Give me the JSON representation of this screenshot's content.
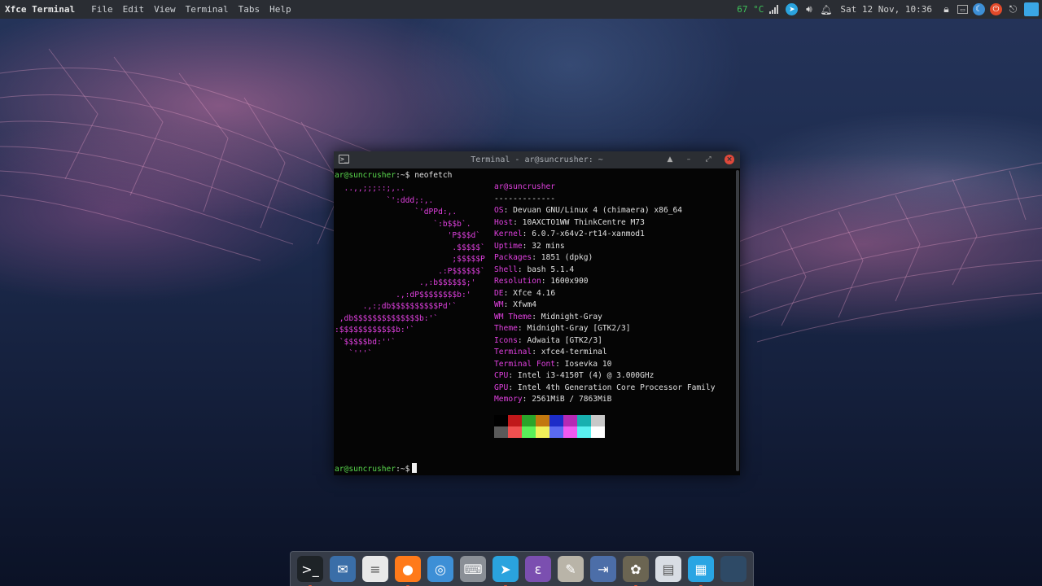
{
  "panel": {
    "app_name": "Xfce Terminal",
    "menus": [
      "File",
      "Edit",
      "View",
      "Terminal",
      "Tabs",
      "Help"
    ],
    "temperature": "67 °C",
    "clock": "Sat 12 Nov, 10:36"
  },
  "terminal": {
    "title": "Terminal - ar@suncrusher: ~",
    "prompt_user": "ar@suncrusher",
    "prompt_path": ":~$",
    "command": "neofetch",
    "ascii_logo": "  ..,,;;;::;,..\n           `':ddd;:,.\n                 `'dPPd:,.\n                     `:b$$b`.\n                        'P$$$d`\n                         .$$$$$`\n                         ;$$$$$P\n                      .:P$$$$$$`\n                  .,:b$$$$$$;'\n             .,:dP$$$$$$$$b:'\n      .,:;db$$$$$$$$$$Pd'`\n ,db$$$$$$$$$$$$$$b:'`\n:$$$$$$$$$$$$b:'`\n `$$$$$bd:''`\n   `'''`",
    "info_header": "ar@suncrusher",
    "separator": "-------------",
    "info": [
      {
        "key": "OS",
        "value": "Devuan GNU/Linux 4 (chimaera) x86_64"
      },
      {
        "key": "Host",
        "value": "10AXCTO1WW ThinkCentre M73"
      },
      {
        "key": "Kernel",
        "value": "6.0.7-x64v2-rt14-xanmod1"
      },
      {
        "key": "Uptime",
        "value": "32 mins"
      },
      {
        "key": "Packages",
        "value": "1851 (dpkg)"
      },
      {
        "key": "Shell",
        "value": "bash 5.1.4"
      },
      {
        "key": "Resolution",
        "value": "1600x900"
      },
      {
        "key": "DE",
        "value": "Xfce 4.16"
      },
      {
        "key": "WM",
        "value": "Xfwm4"
      },
      {
        "key": "WM Theme",
        "value": "Midnight-Gray"
      },
      {
        "key": "Theme",
        "value": "Midnight-Gray [GTK2/3]"
      },
      {
        "key": "Icons",
        "value": "Adwaita [GTK2/3]"
      },
      {
        "key": "Terminal",
        "value": "xfce4-terminal"
      },
      {
        "key": "Terminal Font",
        "value": "Iosevka 10"
      },
      {
        "key": "CPU",
        "value": "Intel i3-4150T (4) @ 3.000GHz"
      },
      {
        "key": "GPU",
        "value": "Intel 4th Generation Core Processor Family"
      },
      {
        "key": "Memory",
        "value": "2561MiB / 7863MiB"
      }
    ],
    "palette_top": [
      "#000000",
      "#c0181a",
      "#2aa52a",
      "#c2780e",
      "#1c2cc8",
      "#b52ab5",
      "#18b0b0",
      "#c8c8c8"
    ],
    "palette_bottom": [
      "#5a5a5a",
      "#f05050",
      "#5af05a",
      "#f0f05a",
      "#5a6af0",
      "#f05af0",
      "#5af0f0",
      "#ffffff"
    ],
    "accent_prompt": "#59d84d",
    "accent_key": "#e040df"
  },
  "dock": {
    "items": [
      {
        "name": "terminal-dock-icon",
        "color": "#1e2327",
        "glyph": ">_"
      },
      {
        "name": "mail-dock-icon",
        "color": "#3a6ea8",
        "glyph": "✉"
      },
      {
        "name": "text-editor-dock-icon",
        "color": "#e8e8e8",
        "glyph": "≡"
      },
      {
        "name": "firefox-dock-icon",
        "color": "#ff7a1a",
        "glyph": "●"
      },
      {
        "name": "chromium-dock-icon",
        "color": "#3d8fd6",
        "glyph": "◎"
      },
      {
        "name": "keyboard-dock-icon",
        "color": "#8a8f96",
        "glyph": "⌨"
      },
      {
        "name": "telegram-dock-icon",
        "color": "#2aa3de",
        "glyph": "➤"
      },
      {
        "name": "emacs-dock-icon",
        "color": "#7b4fb0",
        "glyph": "ε"
      },
      {
        "name": "pencil-cup-dock-icon",
        "color": "#b9b4a8",
        "glyph": "✎"
      },
      {
        "name": "arrow-dock-icon",
        "color": "#4c6ea8",
        "glyph": "⇥"
      },
      {
        "name": "gimp-dock-icon",
        "color": "#6b6552",
        "glyph": "✿"
      },
      {
        "name": "document-viewer-dock-icon",
        "color": "#d8dde4",
        "glyph": "▤"
      },
      {
        "name": "app-grid-dock-icon",
        "color": "#29a5e3",
        "glyph": "▦"
      },
      {
        "name": "extra-dock-icon",
        "color": "#2e4a66",
        "glyph": ""
      }
    ]
  }
}
